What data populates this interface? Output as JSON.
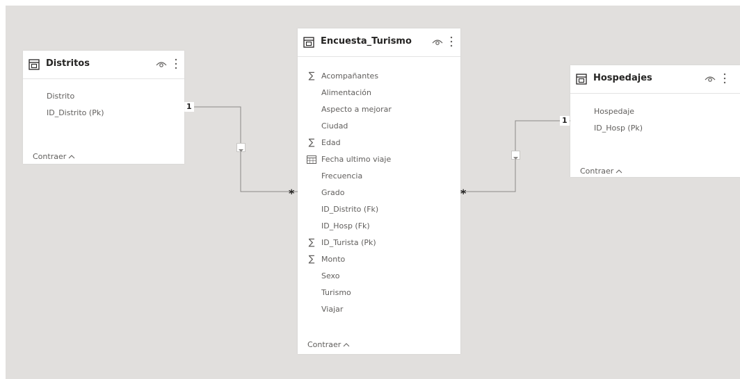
{
  "tables": {
    "distritos": {
      "title": "Distritos",
      "fields": [
        "Distrito",
        "ID_Distrito (Pk)"
      ],
      "collapse_label": "Contraer"
    },
    "encuesta": {
      "title": "Encuesta_Turismo",
      "fields": [
        {
          "label": "Acompañantes",
          "icon": "sigma-icon"
        },
        {
          "label": "Alimentación",
          "icon": ""
        },
        {
          "label": "Aspecto a mejorar",
          "icon": ""
        },
        {
          "label": "Ciudad",
          "icon": ""
        },
        {
          "label": "Edad",
          "icon": "sigma-icon"
        },
        {
          "label": "Fecha ultimo viaje",
          "icon": "calendar-icon"
        },
        {
          "label": "Frecuencia",
          "icon": ""
        },
        {
          "label": "Grado",
          "icon": ""
        },
        {
          "label": "ID_Distrito (Fk)",
          "icon": ""
        },
        {
          "label": "ID_Hosp (Fk)",
          "icon": ""
        },
        {
          "label": "ID_Turista (Pk)",
          "icon": "sigma-icon"
        },
        {
          "label": "Monto",
          "icon": "sigma-icon"
        },
        {
          "label": "Sexo",
          "icon": ""
        },
        {
          "label": "Turismo",
          "icon": ""
        },
        {
          "label": "Viajar",
          "icon": ""
        }
      ],
      "collapse_label": "Contraer"
    },
    "hospedajes": {
      "title": "Hospedajes",
      "fields": [
        "Hospedaje",
        "ID_Hosp (Pk)"
      ],
      "collapse_label": "Contraer"
    }
  },
  "relationships": {
    "distritos_one": "1",
    "distritos_many": "*",
    "hospedajes_one": "1",
    "hospedajes_many": "*"
  },
  "glyphs": {
    "sigma": "∑",
    "chevron_up": "^"
  },
  "colors": {
    "canvas": "#e1dfdd",
    "card": "#ffffff",
    "text": "#605e5c",
    "title": "#252423",
    "line": "#8a8886"
  }
}
